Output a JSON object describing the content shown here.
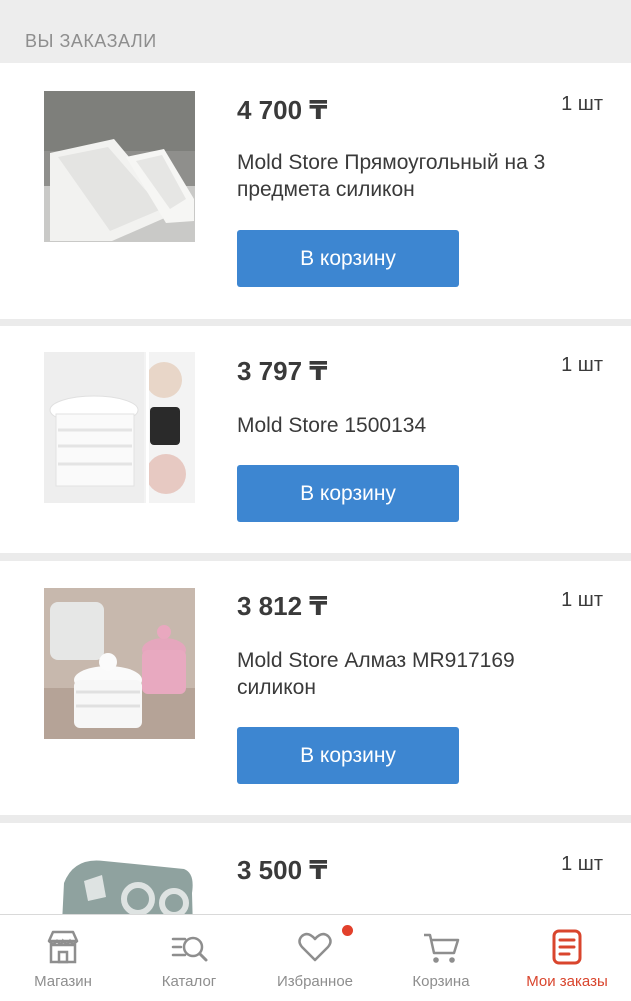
{
  "header": {
    "title": "ВЫ ЗАКАЗАЛИ"
  },
  "orders": [
    {
      "price": "4 700 ₸",
      "qty": "1 шт",
      "title": "Mold Store Прямоугольный на 3 предмета силикон",
      "button": "В корзину",
      "image": "rectangular-silicone-mold-image"
    },
    {
      "price": "3 797 ₸",
      "qty": "1 шт",
      "title": "Mold Store 1500134",
      "button": "В корзину",
      "image": "jar-mold-collage-image"
    },
    {
      "price": "3 812 ₸",
      "qty": "1 шт",
      "title": "Mold Store Алмаз MR917169 силикон",
      "button": "В корзину",
      "image": "diamond-jar-mold-image"
    },
    {
      "price": "3 500 ₸",
      "qty": "1 шт",
      "title": "",
      "button": "",
      "image": "grey-silicone-mold-image"
    }
  ],
  "tabbar": {
    "tabs": [
      {
        "label": "Магазин",
        "icon": "shop-icon"
      },
      {
        "label": "Каталог",
        "icon": "catalog-search-icon"
      },
      {
        "label": "Избранное",
        "icon": "heart-icon",
        "badge": true
      },
      {
        "label": "Корзина",
        "icon": "cart-icon"
      },
      {
        "label": "Мои заказы",
        "icon": "orders-icon",
        "active": true
      }
    ],
    "colors": {
      "active": "#d9452d",
      "inactive": "#8e8e8e",
      "badge": "#e2402b"
    }
  },
  "colors": {
    "button": "#3d86d1",
    "background": "#ebebeb"
  }
}
